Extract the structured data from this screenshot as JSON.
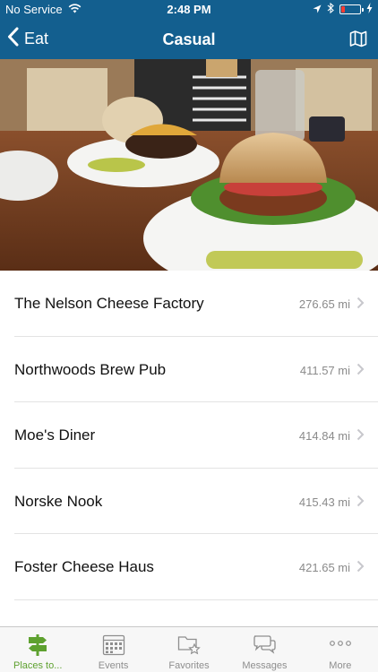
{
  "status_bar": {
    "carrier": "No Service",
    "time": "2:48 PM",
    "battery_level": 0.2,
    "battery_color": "#ff3b30"
  },
  "nav": {
    "back_label": "Eat",
    "title": "Casual",
    "right_icon": "map-icon"
  },
  "hero": {
    "icon": "food-photo"
  },
  "places": [
    {
      "name": "The Nelson Cheese Factory",
      "distance": "276.65 mi"
    },
    {
      "name": "Northwoods Brew Pub",
      "distance": "411.57 mi"
    },
    {
      "name": "Moe's Diner",
      "distance": "414.84 mi"
    },
    {
      "name": "Norske Nook",
      "distance": "415.43 mi"
    },
    {
      "name": "Foster Cheese Haus",
      "distance": "421.65 mi"
    }
  ],
  "tab_bar": {
    "tabs": [
      {
        "label": "Places to...",
        "icon": "signpost-icon",
        "active": true
      },
      {
        "label": "Events",
        "icon": "calendar-icon",
        "active": false
      },
      {
        "label": "Favorites",
        "icon": "favorites-folder-icon",
        "active": false
      },
      {
        "label": "Messages",
        "icon": "chat-bubbles-icon",
        "active": false
      },
      {
        "label": "More",
        "icon": "more-dots-icon",
        "active": false
      }
    ]
  },
  "colors": {
    "header": "#135f8f",
    "active_tab": "#5ea12f",
    "inactive_tab": "#8e8e8e"
  }
}
